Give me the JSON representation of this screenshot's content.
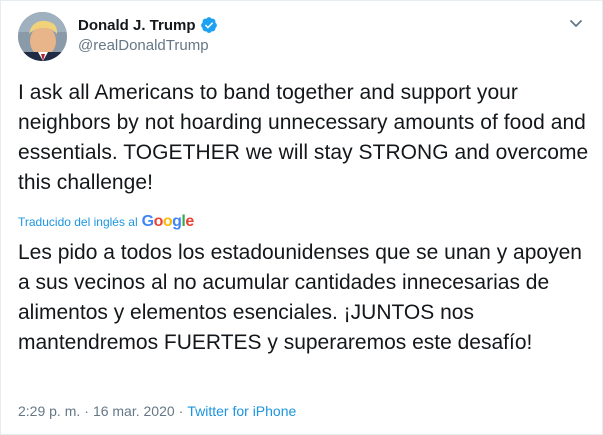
{
  "author": {
    "name": "Donald J. Trump",
    "handle": "@realDonaldTrump",
    "verified": true
  },
  "tweet": {
    "text": "I ask all Americans to band together and support your neighbors by not hoarding unnecessary amounts of food and essentials. TOGETHER we will stay STRONG and overcome this challenge!"
  },
  "translation": {
    "label": "Traducido del inglés al",
    "provider": [
      "G",
      "o",
      "o",
      "g",
      "l",
      "e"
    ],
    "text": "Les pido a todos los estadounidenses que se unan y apoyen a sus vecinos al no acumular cantidades innecesarias de alimentos y elementos esenciales. ¡JUNTOS nos mantendremos FUERTES y superaremos este desafío!"
  },
  "meta": {
    "time": "2:29 p. m.",
    "separator": "·",
    "date": "16 mar. 2020",
    "separator2": "·",
    "source": "Twitter for iPhone"
  },
  "icons": {
    "verified": "verified-badge-icon",
    "caret": "chevron-down-icon"
  },
  "colors": {
    "accent": "#1b95e0",
    "verified": "#1da1f2",
    "muted": "#657786",
    "text": "#14171a"
  }
}
